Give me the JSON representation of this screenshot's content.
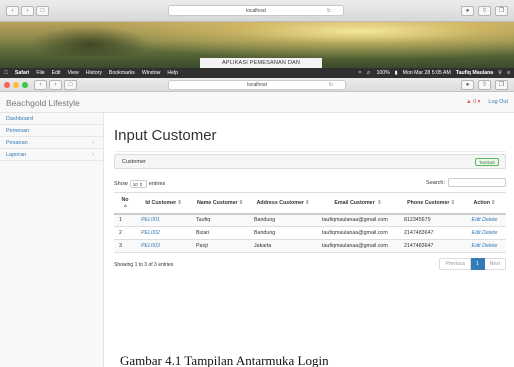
{
  "back_window": {
    "url": "localhost",
    "photo_caption": "APLIKASI PEMESANAN DAN"
  },
  "menubar": {
    "app": "Safari",
    "menus": [
      "File",
      "Edit",
      "View",
      "History",
      "Bookmarks",
      "Window",
      "Help"
    ],
    "battery": "100%",
    "clock": "Mon Mar 28  5:05 AM",
    "user": "Taufiq Maulana"
  },
  "browser": {
    "url": "localhost"
  },
  "header": {
    "brand": "Beachgold Lifestyle",
    "alert": "▲ 0 ▾",
    "logout": "Log Out"
  },
  "sidebar": {
    "items": [
      {
        "label": "Dashboard",
        "arrow": ""
      },
      {
        "label": "Pemesan",
        "arrow": ""
      },
      {
        "label": "Pesanan",
        "arrow": "›"
      },
      {
        "label": "Laporan",
        "arrow": "›"
      }
    ]
  },
  "main": {
    "title": "Input Customer",
    "panel_label": "Customer",
    "add_button": "Tambah",
    "show_label": "Show",
    "entries_value": "10",
    "entries_label": "entries",
    "search_label": "Search:",
    "search_value": ""
  },
  "table": {
    "columns": [
      "No",
      "Id Customer",
      "Name Customer",
      "Address Customer",
      "Email Customer",
      "Phone Customer",
      "Action"
    ],
    "rows": [
      {
        "no": "1",
        "id": "PEL001",
        "name": "Taufiq",
        "address": "Bandung",
        "email": "taufiqmaulanaa@gmail.com",
        "phone": "812345679",
        "action": "Edit Delete"
      },
      {
        "no": "2",
        "id": "PEL002",
        "name": "Bizari",
        "address": "Bandung",
        "email": "taufiqmaulanaa@gmail.com",
        "phone": "2147483647",
        "action": "Edit Delete"
      },
      {
        "no": "3",
        "id": "PEL003",
        "name": "Panji",
        "address": "Jakarta",
        "email": "taufiqmaulanaa@gmail.com",
        "phone": "2147483647",
        "action": "Edit Delete"
      }
    ]
  },
  "footer": {
    "info": "Showing 1 to 3 of 3 entries",
    "prev": "Previous",
    "page": "1",
    "next": "Next"
  },
  "doc_caption": "Gambar 4.1 Tampilan Antarmuka Login"
}
